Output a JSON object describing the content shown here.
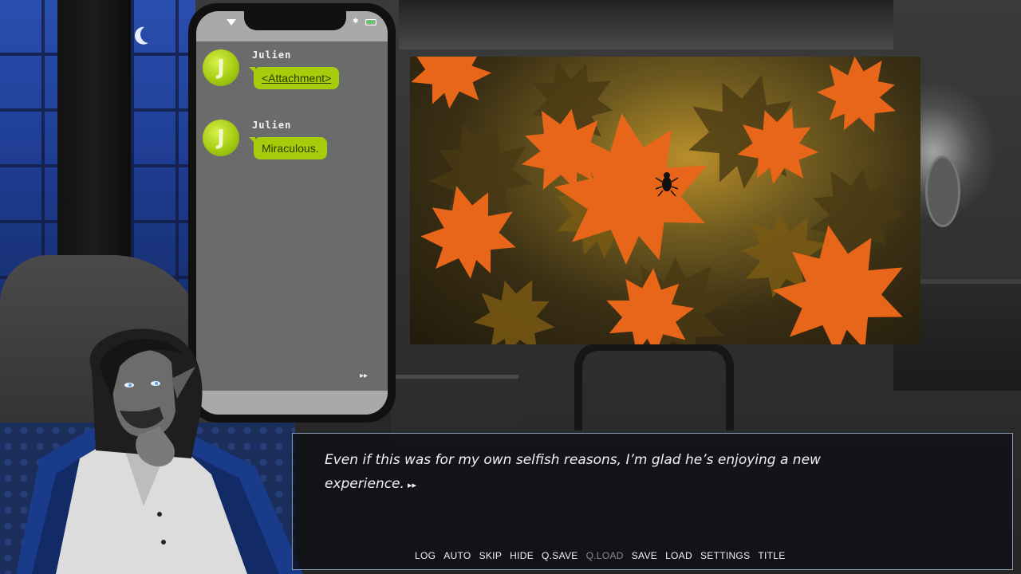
{
  "phone": {
    "messages": [
      {
        "avatar_letter": "J",
        "sender": "Julien",
        "text": "<Attachment>",
        "is_link": true
      },
      {
        "avatar_letter": "J",
        "sender": "Julien",
        "text": "Miraculous.",
        "is_link": false
      }
    ],
    "advance_glyph": "▸▸",
    "bluetooth_glyph": "✱"
  },
  "dialogue": {
    "line1": "Even if this was for my own selfish reasons, I’m glad he’s enjoying a new",
    "line2": "experience.",
    "ctc_glyph": "▸▸"
  },
  "quick_menu": [
    {
      "label": "LOG",
      "enabled": true
    },
    {
      "label": "AUTO",
      "enabled": true
    },
    {
      "label": "SKIP",
      "enabled": true
    },
    {
      "label": "HIDE",
      "enabled": true
    },
    {
      "label": "Q.SAVE",
      "enabled": true
    },
    {
      "label": "Q.LOAD",
      "enabled": false
    },
    {
      "label": "SAVE",
      "enabled": true
    },
    {
      "label": "LOAD",
      "enabled": true
    },
    {
      "label": "SETTINGS",
      "enabled": true
    },
    {
      "label": "TITLE",
      "enabled": true
    }
  ],
  "colors": {
    "bubble": "#a7cc0c",
    "avatar": "#a4cc12",
    "phone_screen": "#6b6b6b",
    "night_window": "#2b4fb0",
    "leaf_orange": "#f07a1a"
  },
  "icons": {
    "signal": "signal-icon",
    "battery": "battery-icon",
    "bluetooth": "bluetooth-icon",
    "moon": "moon-icon",
    "beetle": "beetle-icon"
  }
}
